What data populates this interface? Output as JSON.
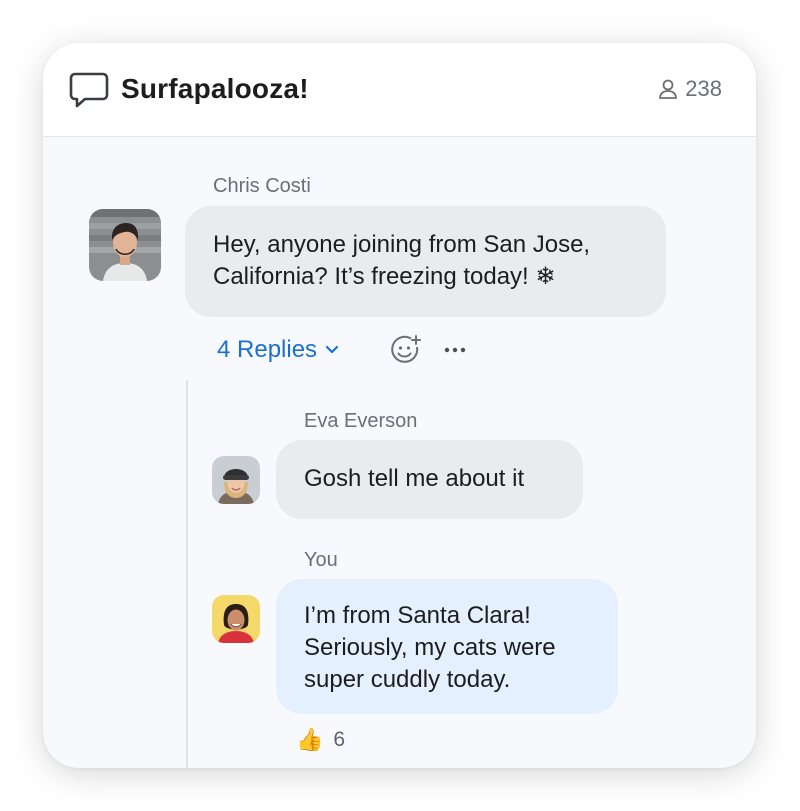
{
  "header": {
    "icon": "chat-bubble-icon",
    "title": "Surfapalooza!",
    "participant_icon": "person-icon",
    "participant_count": "238"
  },
  "messages": [
    {
      "sender": "Chris Costi",
      "lines": [
        "Hey, anyone joining from San Jose,",
        "California? It’s freezing today! ❄"
      ],
      "avatar": "avatar-chris"
    }
  ],
  "message_actions": {
    "replies_label": "4 Replies",
    "replies_icon": "chevron-down-icon",
    "reaction_add_icon": "add-reaction-icon",
    "more_icon": "more-options-icon"
  },
  "replies": [
    {
      "sender": "Eva Everson",
      "lines": [
        "Gosh tell me about it"
      ],
      "avatar": "avatar-eva"
    },
    {
      "sender": "You",
      "lines": [
        "I’m from Santa Clara!",
        "Seriously, my cats were",
        "super cuddly today."
      ],
      "avatar": "avatar-you",
      "reaction": {
        "emoji": "👍",
        "icon": "thumbs-up-icon",
        "count": "6"
      }
    }
  ],
  "colors": {
    "accent": "#1b6fd1",
    "bubble_grey": "#e9ebee",
    "bubble_own": "#e4f0fd",
    "background": "#f7f9fc"
  }
}
